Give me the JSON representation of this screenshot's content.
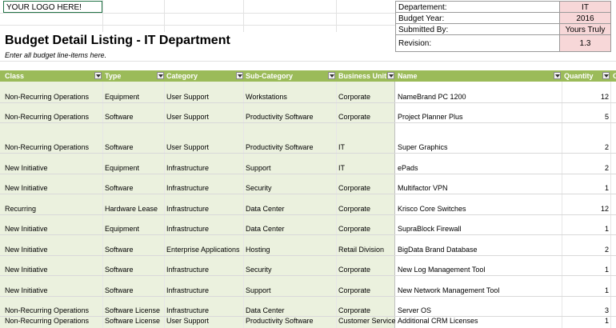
{
  "logo": "YOUR LOGO HERE!",
  "title": "Budget Detail Listing - IT Department",
  "subtitle": "Enter all budget line-items here.",
  "info": [
    {
      "label": "Departement:",
      "value": "IT"
    },
    {
      "label": "Budget Year:",
      "value": "2016"
    },
    {
      "label": "Submitted By:",
      "value": "Yours Truly"
    },
    {
      "label": "Revision:",
      "value": "1.3"
    }
  ],
  "headers": [
    "Class",
    "Type",
    "Category",
    "Sub-Category",
    "Business Unit",
    "Name",
    "Quantity",
    "C"
  ],
  "rows": [
    [
      "Non-Recurring Operations",
      "Equipment",
      "User Support",
      "Workstations",
      "Corporate",
      "NameBrand PC 1200",
      "12"
    ],
    [
      "Non-Recurring Operations",
      "Software",
      "User Support",
      "Productivity Software",
      "Corporate",
      "Project Planner Plus",
      "5"
    ],
    [
      "Non-Recurring Operations",
      "Software",
      "User Support",
      "Productivity Software",
      "IT",
      "Super Graphics",
      "2"
    ],
    [
      "New Initiative",
      "Equipment",
      "Infrastructure",
      "Support",
      "IT",
      "ePads",
      "2"
    ],
    [
      "New Initiative",
      "Software",
      "Infrastructure",
      "Security",
      "Corporate",
      "Multifactor VPN",
      "1"
    ],
    [
      "Recurring",
      "Hardware Lease",
      "Infrastructure",
      "Data Center",
      "Corporate",
      "Krisco Core Switches",
      "12"
    ],
    [
      "New Initiative",
      "Equipment",
      "Infrastructure",
      "Data Center",
      "Corporate",
      "SupraBlock Firewall",
      "1"
    ],
    [
      "New Initiative",
      "Software",
      "Enterprise Applications",
      "Hosting",
      "Retail Division",
      "BigData Brand Database",
      "2"
    ],
    [
      "New Initiative",
      "Software",
      "Infrastructure",
      "Security",
      "Corporate",
      "New Log Management Tool",
      "1"
    ],
    [
      "New Initiative",
      "Software",
      "Infrastructure",
      "Support",
      "Corporate",
      "New Network Management Tool",
      "1"
    ],
    [
      "Non-Recurring Operations",
      "Software License",
      "Infrastructure",
      "Data Center",
      "Corporate",
      "Server OS",
      "3"
    ],
    [
      "Non-Recurring Operations",
      "Software License",
      "User Support",
      "Productivity Software",
      "Customer Service",
      "Additional CRM Licenses",
      "1"
    ]
  ]
}
